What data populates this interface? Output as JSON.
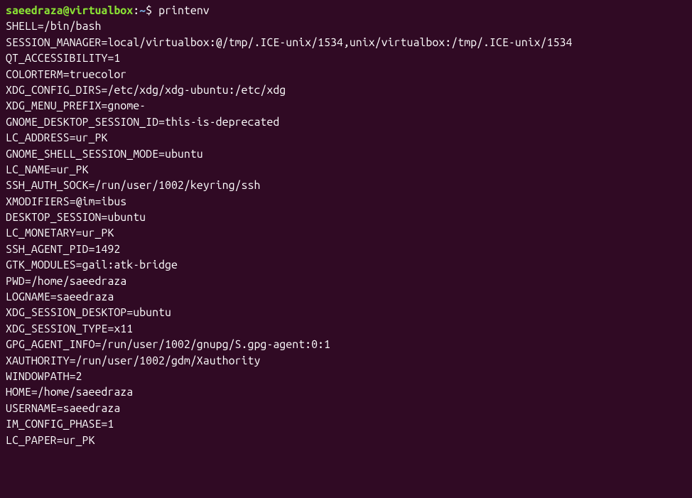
{
  "prompt": {
    "user_host": "saeedraza@virtualbox",
    "colon": ":",
    "path": "~",
    "dollar": "$ ",
    "command": "printenv"
  },
  "output": [
    "SHELL=/bin/bash",
    "SESSION_MANAGER=local/virtualbox:@/tmp/.ICE-unix/1534,unix/virtualbox:/tmp/.ICE-unix/1534",
    "QT_ACCESSIBILITY=1",
    "COLORTERM=truecolor",
    "XDG_CONFIG_DIRS=/etc/xdg/xdg-ubuntu:/etc/xdg",
    "XDG_MENU_PREFIX=gnome-",
    "GNOME_DESKTOP_SESSION_ID=this-is-deprecated",
    "LC_ADDRESS=ur_PK",
    "GNOME_SHELL_SESSION_MODE=ubuntu",
    "LC_NAME=ur_PK",
    "SSH_AUTH_SOCK=/run/user/1002/keyring/ssh",
    "XMODIFIERS=@im=ibus",
    "DESKTOP_SESSION=ubuntu",
    "LC_MONETARY=ur_PK",
    "SSH_AGENT_PID=1492",
    "GTK_MODULES=gail:atk-bridge",
    "PWD=/home/saeedraza",
    "LOGNAME=saeedraza",
    "XDG_SESSION_DESKTOP=ubuntu",
    "XDG_SESSION_TYPE=x11",
    "GPG_AGENT_INFO=/run/user/1002/gnupg/S.gpg-agent:0:1",
    "XAUTHORITY=/run/user/1002/gdm/Xauthority",
    "WINDOWPATH=2",
    "HOME=/home/saeedraza",
    "USERNAME=saeedraza",
    "IM_CONFIG_PHASE=1",
    "LC_PAPER=ur_PK"
  ]
}
